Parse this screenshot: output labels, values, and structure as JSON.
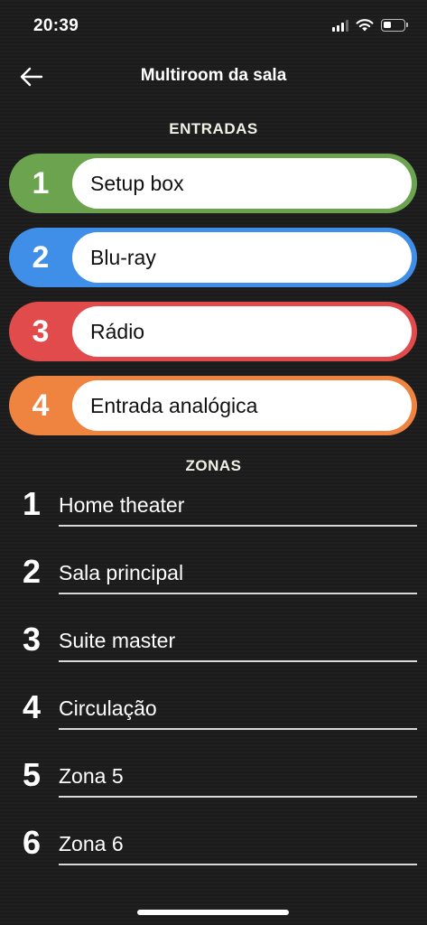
{
  "status_bar": {
    "time": "20:39"
  },
  "header": {
    "title": "Multiroom da sala"
  },
  "inputs": {
    "section_title": "ENTRADAS",
    "items": [
      {
        "number": "1",
        "label": "Setup box",
        "color": "#6ca34f"
      },
      {
        "number": "2",
        "label": "Blu-ray",
        "color": "#3f8fe8"
      },
      {
        "number": "3",
        "label": "Rádio",
        "color": "#e24b4b"
      },
      {
        "number": "4",
        "label": "Entrada analógica",
        "color": "#ee843f"
      }
    ]
  },
  "zones": {
    "section_title": "ZONAS",
    "items": [
      {
        "number": "1",
        "label": "Home theater"
      },
      {
        "number": "2",
        "label": "Sala principal"
      },
      {
        "number": "3",
        "label": "Suite master"
      },
      {
        "number": "4",
        "label": "Circulação"
      },
      {
        "number": "5",
        "label": "Zona 5"
      },
      {
        "number": "6",
        "label": "Zona 6"
      }
    ]
  }
}
